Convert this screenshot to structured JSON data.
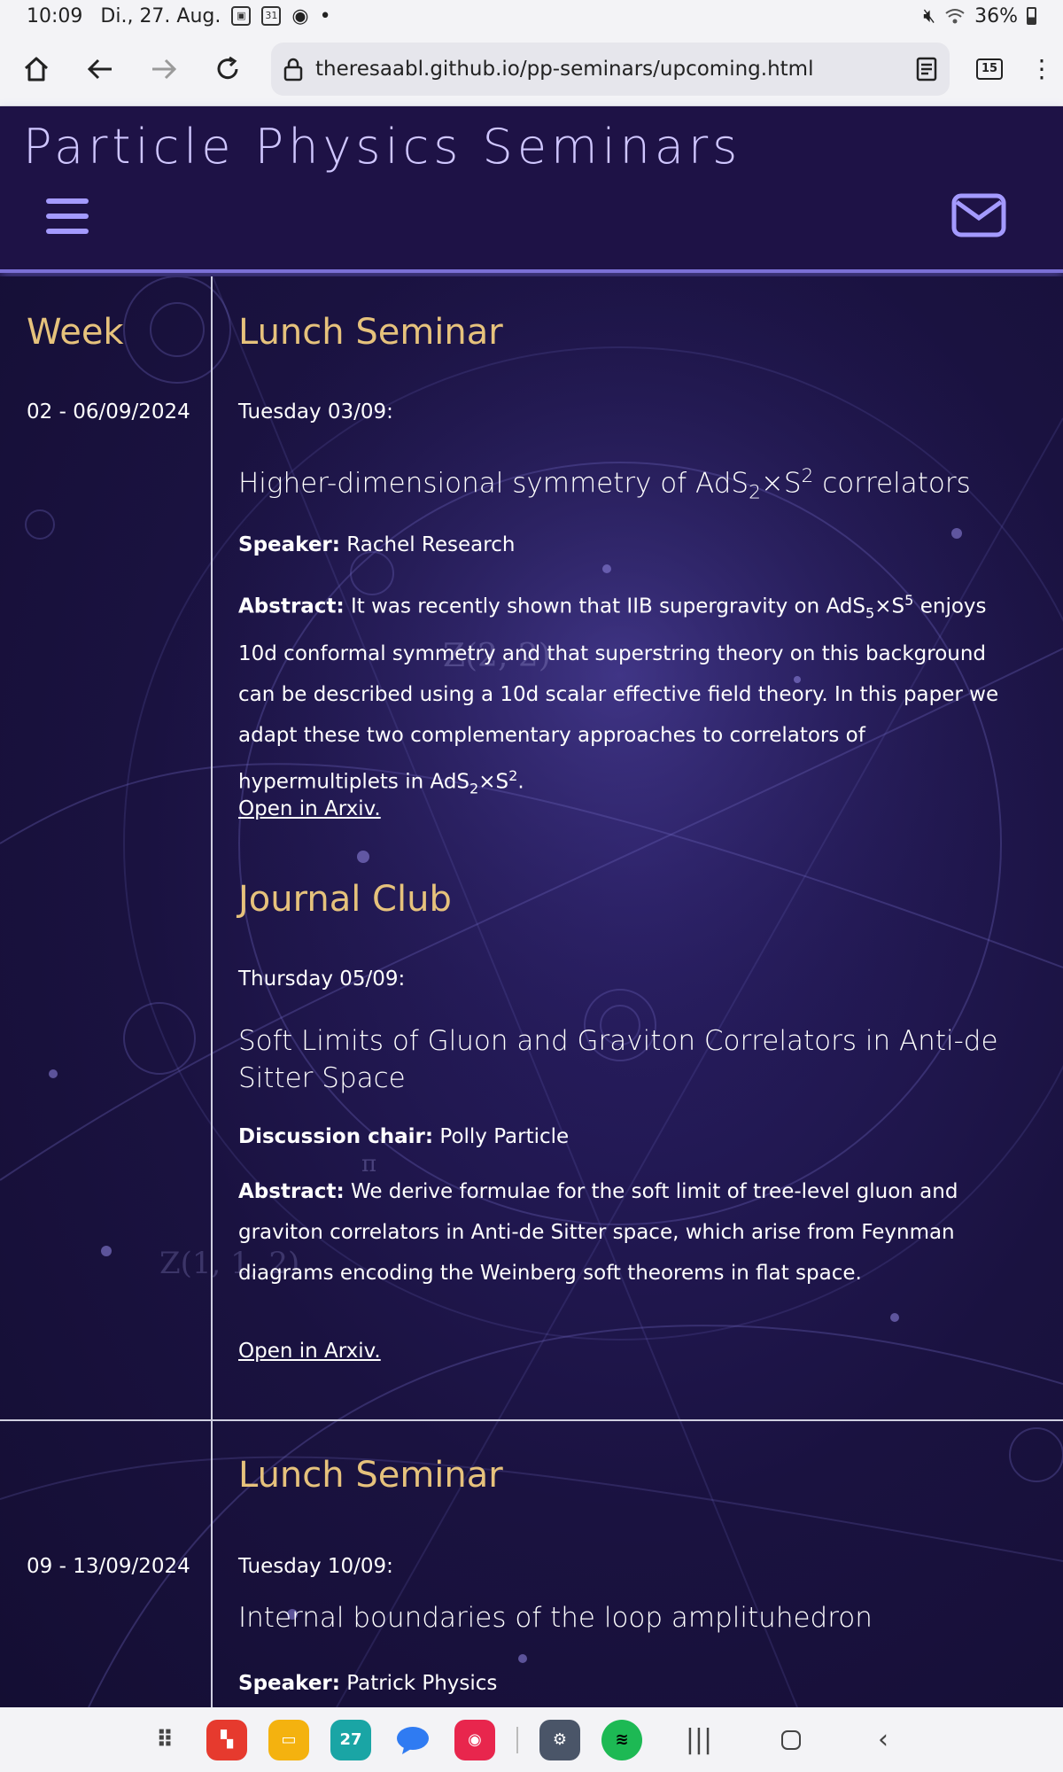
{
  "status_bar": {
    "time": "10:09",
    "date": "Di., 27. Aug.",
    "calendar_badge": "31",
    "dot": "•",
    "battery": "36%"
  },
  "browser": {
    "url": "theresaabl.github.io/pp-seminars/upcoming.html",
    "tab_count": "15"
  },
  "site": {
    "title": "Particle Physics Seminars",
    "accent_color": "#e6c27c",
    "header_color": "#1e1246"
  },
  "table": {
    "week_header": "Week",
    "weeks": [
      {
        "range": "02 - 06/09/2024",
        "events": [
          {
            "section": "Lunch Seminar",
            "day": "Tuesday 03/09:",
            "title_pre": "Higher-dimensional symmetry of AdS",
            "title_sub1": "2",
            "title_mid": "×S",
            "title_sup1": "2",
            "title_post": " correlators",
            "person_label": "Speaker:",
            "person": "Rachel Research",
            "abstract_label": "Abstract:",
            "abstract_a": "It was recently shown that IIB supergravity on AdS",
            "abstract_sub1": "5",
            "abstract_b": "×S",
            "abstract_sup1": "5",
            "abstract_c": " enjoys 10d conformal symmetry and that superstring theory on this background can be described using a 10d scalar effective field theory. In this paper we adapt these two complementary approaches to correlators of hypermultiplets in AdS",
            "abstract_sub2": "2",
            "abstract_d": "×S",
            "abstract_sup2": "2",
            "abstract_e": ".",
            "link": "Open in Arxiv."
          },
          {
            "section": "Journal Club",
            "day": "Thursday 05/09:",
            "title": "Soft Limits of Gluon and Graviton Correlators in Anti-de Sitter Space",
            "person_label": "Discussion chair:",
            "person": "Polly Particle",
            "abstract_label": "Abstract:",
            "abstract": "We derive formulae for the soft limit of tree-level gluon and graviton correlators in Anti-de Sitter space, which arise from Feynman diagrams encoding the Weinberg soft theorems in flat space.",
            "link": "Open in Arxiv."
          }
        ]
      },
      {
        "range": "09 - 13/09/2024",
        "events": [
          {
            "section": "Lunch Seminar",
            "day": "Tuesday 10/09:",
            "title": "Internal boundaries of the loop amplituhedron",
            "person_label": "Speaker:",
            "person": "Patrick Physics"
          }
        ]
      }
    ]
  },
  "background_text": {
    "formula1": "Z(2, 2)",
    "formula2": "Z(1, 1, 2)",
    "pi": "π"
  },
  "dock": {
    "apps": [
      "app-drawer-icon",
      "flipboard-icon",
      "files-icon",
      "calendar-icon",
      "messages-icon",
      "camera-icon",
      "settings-icon",
      "spotify-icon"
    ],
    "calendar_day": "27"
  }
}
